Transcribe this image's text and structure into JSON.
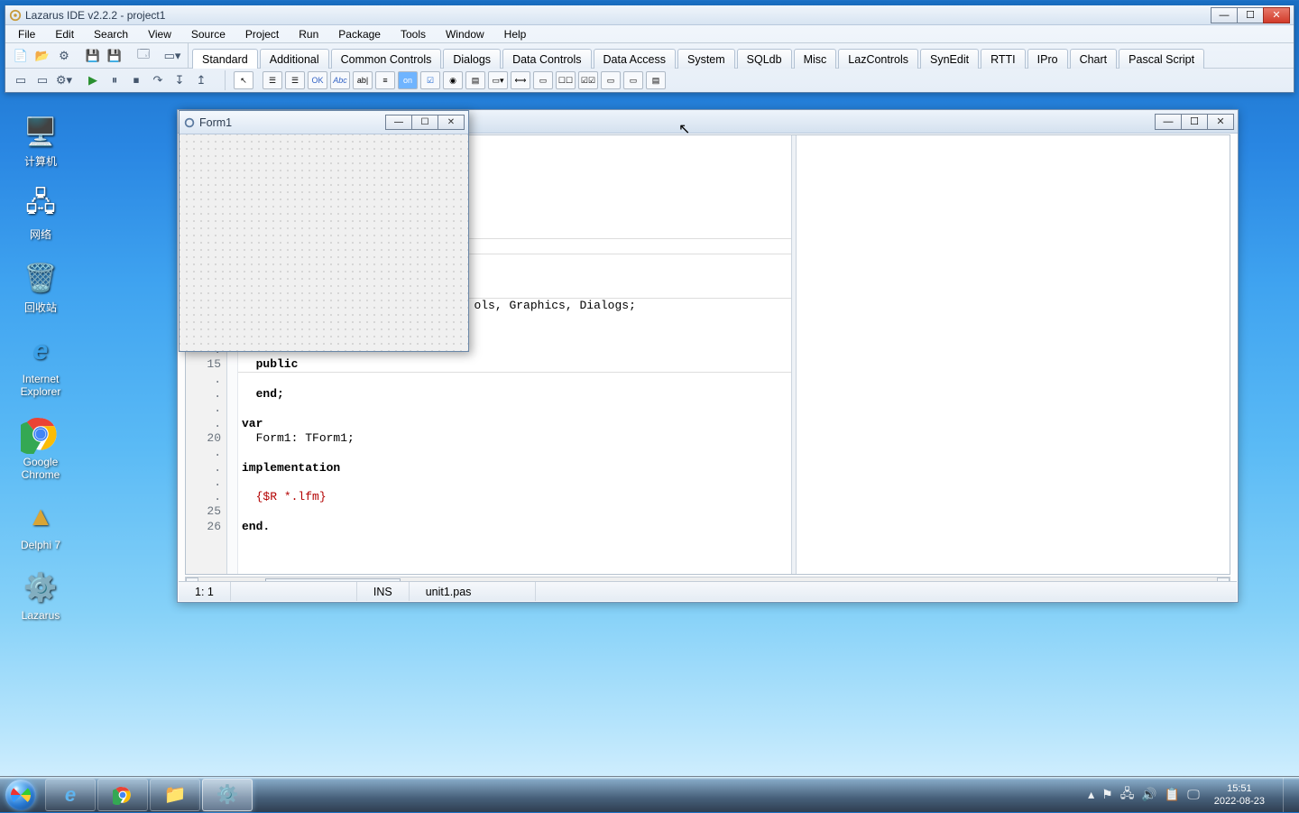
{
  "app": {
    "title": "Lazarus IDE v2.2.2 - project1"
  },
  "menu": {
    "file": "File",
    "edit": "Edit",
    "search": "Search",
    "view": "View",
    "source": "Source",
    "project": "Project",
    "run": "Run",
    "package": "Package",
    "tools": "Tools",
    "window": "Window",
    "help": "Help"
  },
  "palette_tabs": [
    "Standard",
    "Additional",
    "Common Controls",
    "Dialogs",
    "Data Controls",
    "Data Access",
    "System",
    "SQLdb",
    "Misc",
    "LazControls",
    "SynEdit",
    "RTTI",
    "IPro",
    "Chart",
    "Pascal Script"
  ],
  "active_tab_index": 0,
  "form_designer": {
    "title": "Form1"
  },
  "editor": {
    "gutter_lines": [
      ".",
      ".",
      ".",
      ".",
      "15",
      ".",
      ".",
      ".",
      ".",
      "20",
      ".",
      ".",
      ".",
      ".",
      "25",
      "26"
    ],
    "code_lines": [
      {
        "plain": "                                 ols, Graphics, Dialogs;"
      },
      {
        "plain": ""
      },
      {
        "plain": ""
      },
      {
        "plain": ""
      },
      {
        "kw": "  public"
      },
      {
        "plain": ""
      },
      {
        "kw": "  end;"
      },
      {
        "plain": ""
      },
      {
        "kw": "var"
      },
      {
        "plain": "  Form1: TForm1;"
      },
      {
        "plain": ""
      },
      {
        "kw": "implementation"
      },
      {
        "plain": ""
      },
      {
        "dir": "{$R *.lfm}"
      },
      {
        "plain": ""
      },
      {
        "kw": "end."
      },
      {
        "plain": ""
      }
    ],
    "statusbar": {
      "pos": "1:   1",
      "mode": "INS",
      "file": "unit1.pas"
    }
  },
  "desktop_icons": [
    {
      "label": "计算机",
      "key": "computer"
    },
    {
      "label": "网络",
      "key": "network"
    },
    {
      "label": "回收站",
      "key": "recycle"
    },
    {
      "label": "Internet Explorer",
      "key": "ie"
    },
    {
      "label": "Google Chrome",
      "key": "chrome"
    },
    {
      "label": "Delphi 7",
      "key": "delphi"
    },
    {
      "label": "Lazarus",
      "key": "lazarus"
    }
  ],
  "taskbar": {
    "items": [
      "ie",
      "chrome",
      "explorer",
      "lazarus"
    ],
    "active_index": 3,
    "clock_time": "15:51",
    "clock_date": "2022-08-23"
  }
}
